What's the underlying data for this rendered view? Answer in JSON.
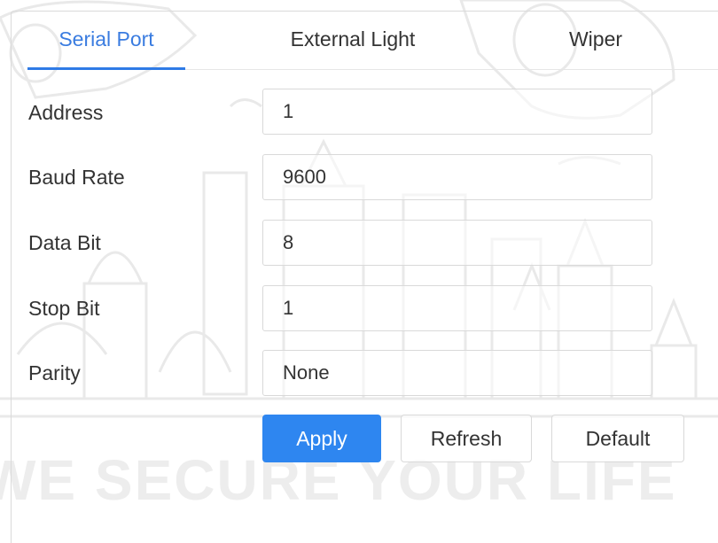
{
  "tabs": [
    {
      "label": "Serial Port",
      "active": true
    },
    {
      "label": "External Light",
      "active": false
    },
    {
      "label": "Wiper",
      "active": false
    }
  ],
  "form": {
    "address": {
      "label": "Address",
      "value": "1"
    },
    "baud_rate": {
      "label": "Baud Rate",
      "value": "9600"
    },
    "data_bit": {
      "label": "Data Bit",
      "value": "8"
    },
    "stop_bit": {
      "label": "Stop Bit",
      "value": "1"
    },
    "parity": {
      "label": "Parity",
      "value": "None"
    }
  },
  "buttons": {
    "apply": "Apply",
    "refresh": "Refresh",
    "default": "Default"
  },
  "watermark_text": "WE SECURE YOUR LIFE",
  "colors": {
    "accent": "#2e86f0",
    "active_tab": "#3a7ce0",
    "border": "#d9d9d9"
  }
}
